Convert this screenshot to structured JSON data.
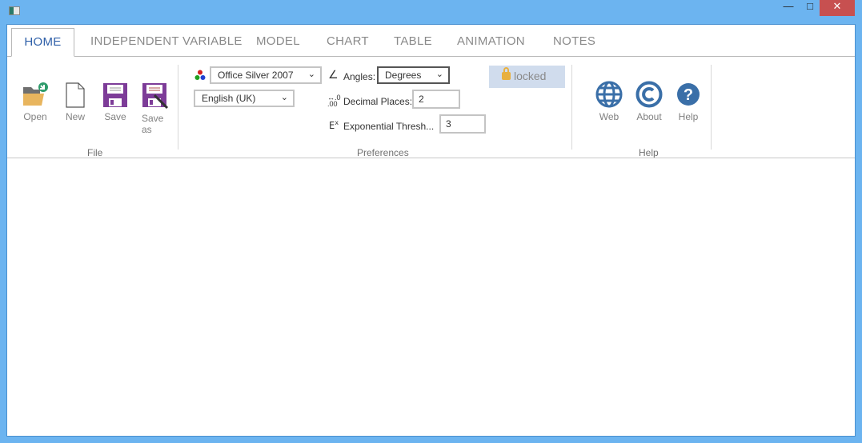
{
  "window": {
    "close_color": "#c75050",
    "frame_color": "#6cb4f0"
  },
  "tabs": [
    "HOME",
    "INDEPENDENT VARIABLE",
    "MODEL",
    "CHART",
    "TABLE",
    "ANIMATION",
    "NOTES"
  ],
  "file_group": {
    "label": "File",
    "buttons": {
      "open": "Open",
      "new": "New",
      "save": "Save",
      "save_as": "Save as"
    }
  },
  "preferences": {
    "label": "Preferences",
    "theme": "Office Silver 2007",
    "language": "English (UK)",
    "angles_label": "Angles:",
    "angles_value": "Degrees",
    "decimal_label": "Decimal Places:",
    "decimal_value": "2",
    "exp_label": "Exponential Thresh...",
    "exp_value": "3",
    "exp_icon_text": "E",
    "locked": "locked"
  },
  "help_group": {
    "label": "Help",
    "buttons": {
      "web": "Web",
      "about": "About",
      "help": "Help"
    }
  },
  "accent": "#3a6fa8"
}
